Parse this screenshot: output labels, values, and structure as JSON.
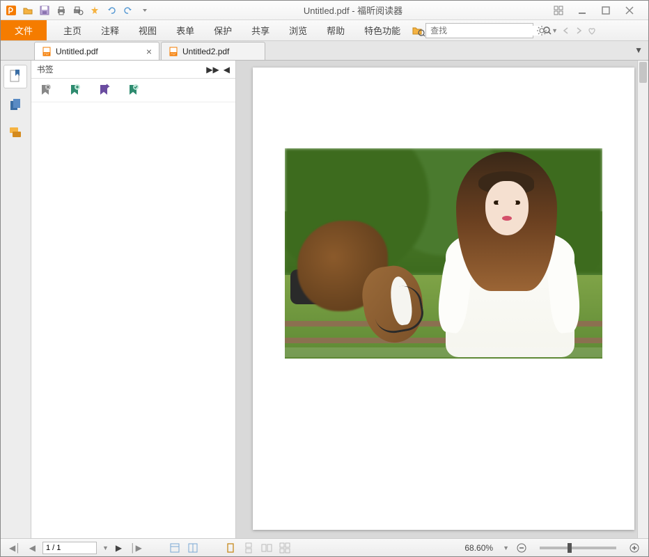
{
  "titlebar": {
    "title": "Untitled.pdf - 福昕阅读器"
  },
  "menu": {
    "file": "文件",
    "items": [
      "主页",
      "注释",
      "视图",
      "表单",
      "保护",
      "共享",
      "浏览",
      "帮助",
      "特色功能"
    ],
    "search_placeholder": "查找"
  },
  "tabs": [
    {
      "label": "Untitled.pdf",
      "active": true
    },
    {
      "label": "Untitled2.pdf",
      "active": false
    }
  ],
  "bookmark": {
    "title": "书签"
  },
  "status": {
    "page": "1 / 1",
    "zoom": "68.60%"
  }
}
